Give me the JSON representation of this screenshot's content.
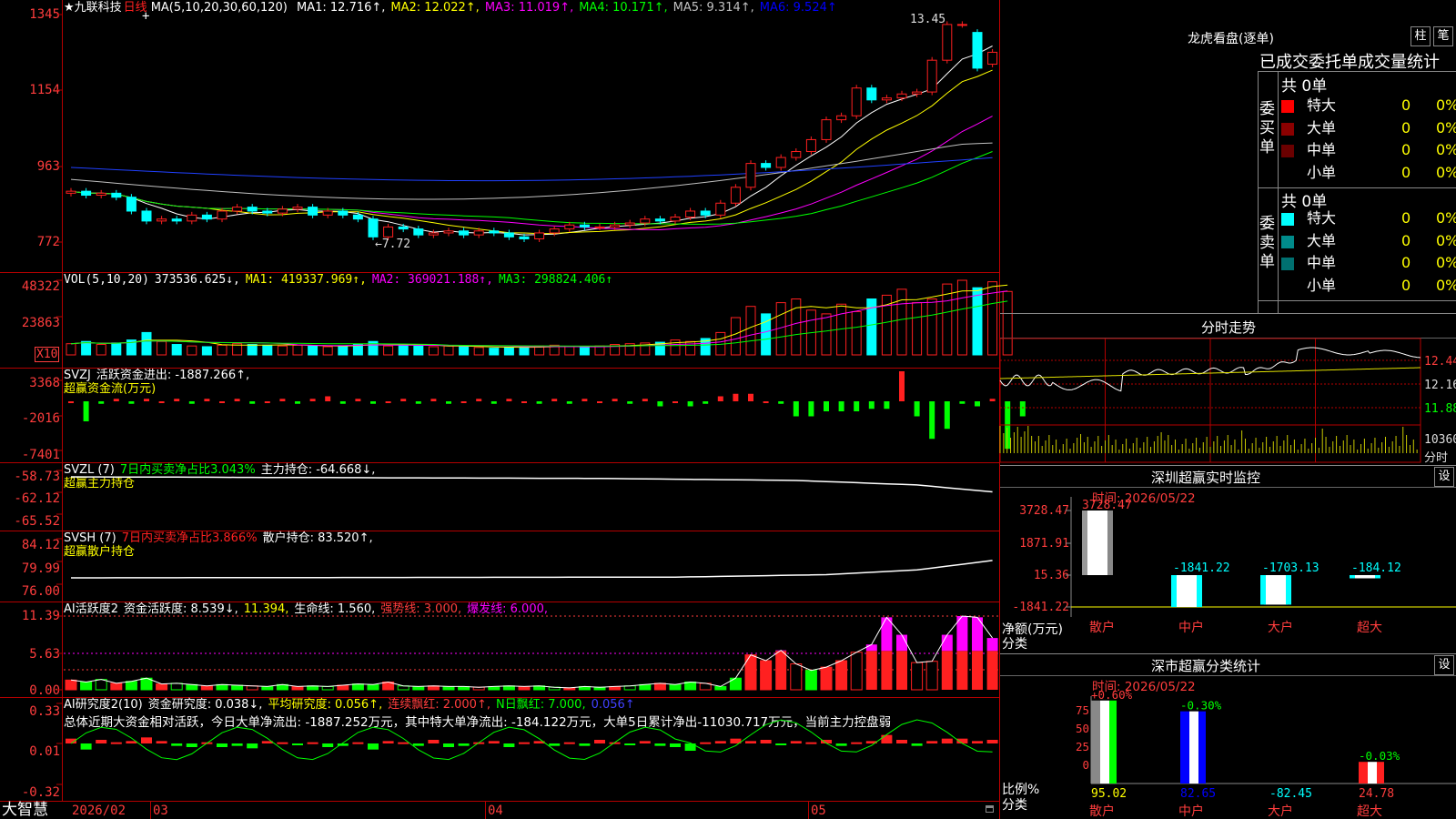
{
  "title": {
    "star": "★",
    "stock_name": "九联科技",
    "period": "日线",
    "plus": "+",
    "ma_label": "MA(5,10,20,30,60,120)",
    "ma_values": [
      {
        "text": "MA1: 12.716↑,",
        "color": "#ffffff"
      },
      {
        "text": "MA2: 12.022↑,",
        "color": "#ffff00"
      },
      {
        "text": "MA3: 11.019↑,",
        "color": "#ff00ff"
      },
      {
        "text": "MA4: 10.171↑,",
        "color": "#00ff00"
      },
      {
        "text": "MA5: 9.314↑,",
        "color": "#c0c0c0"
      },
      {
        "text": "MA6: 9.524↑",
        "color": "#0000ff"
      }
    ]
  },
  "main_chart": {
    "y_labels": [
      "1345",
      "1154",
      "963",
      "772"
    ],
    "high_mark": "13.45",
    "low_mark": "←7.72",
    "candles": [
      {
        "o": 8.95,
        "c": 9.0
      },
      {
        "o": 9.0,
        "c": 8.9
      },
      {
        "o": 8.9,
        "c": 8.95
      },
      {
        "o": 8.95,
        "c": 8.85
      },
      {
        "o": 8.85,
        "c": 8.5
      },
      {
        "o": 8.5,
        "c": 8.25
      },
      {
        "o": 8.25,
        "c": 8.3
      },
      {
        "o": 8.3,
        "c": 8.25
      },
      {
        "o": 8.25,
        "c": 8.4
      },
      {
        "o": 8.4,
        "c": 8.3
      },
      {
        "o": 8.3,
        "c": 8.5
      },
      {
        "o": 8.5,
        "c": 8.6
      },
      {
        "o": 8.6,
        "c": 8.5
      },
      {
        "o": 8.5,
        "c": 8.45
      },
      {
        "o": 8.45,
        "c": 8.55
      },
      {
        "o": 8.55,
        "c": 8.6
      },
      {
        "o": 8.6,
        "c": 8.4
      },
      {
        "o": 8.4,
        "c": 8.5
      },
      {
        "o": 8.5,
        "c": 8.4
      },
      {
        "o": 8.4,
        "c": 8.3
      },
      {
        "o": 8.3,
        "c": 7.85
      },
      {
        "o": 7.85,
        "c": 8.1
      },
      {
        "o": 8.1,
        "c": 8.05
      },
      {
        "o": 8.05,
        "c": 7.9
      },
      {
        "o": 7.9,
        "c": 7.95
      },
      {
        "o": 7.95,
        "c": 8.0
      },
      {
        "o": 8.0,
        "c": 7.9
      },
      {
        "o": 7.9,
        "c": 8.0
      },
      {
        "o": 8.0,
        "c": 7.95
      },
      {
        "o": 7.95,
        "c": 7.85
      },
      {
        "o": 7.85,
        "c": 7.8
      },
      {
        "o": 7.8,
        "c": 7.95
      },
      {
        "o": 7.95,
        "c": 8.05
      },
      {
        "o": 8.05,
        "c": 8.15
      },
      {
        "o": 8.15,
        "c": 8.1
      },
      {
        "o": 8.1,
        "c": 8.1
      },
      {
        "o": 8.1,
        "c": 8.15
      },
      {
        "o": 8.15,
        "c": 8.2
      },
      {
        "o": 8.2,
        "c": 8.3
      },
      {
        "o": 8.3,
        "c": 8.25
      },
      {
        "o": 8.25,
        "c": 8.35
      },
      {
        "o": 8.35,
        "c": 8.5
      },
      {
        "o": 8.5,
        "c": 8.4
      },
      {
        "o": 8.4,
        "c": 8.7
      },
      {
        "o": 8.7,
        "c": 9.1
      },
      {
        "o": 9.1,
        "c": 9.7
      },
      {
        "o": 9.7,
        "c": 9.6
      },
      {
        "o": 9.6,
        "c": 9.85
      },
      {
        "o": 9.85,
        "c": 10.0
      },
      {
        "o": 10.0,
        "c": 10.3
      },
      {
        "o": 10.3,
        "c": 10.8
      },
      {
        "o": 10.8,
        "c": 10.9
      },
      {
        "o": 10.9,
        "c": 11.6
      },
      {
        "o": 11.6,
        "c": 11.3
      },
      {
        "o": 11.3,
        "c": 11.35
      },
      {
        "o": 11.35,
        "c": 11.45
      },
      {
        "o": 11.45,
        "c": 11.5
      },
      {
        "o": 11.5,
        "c": 12.3
      },
      {
        "o": 12.3,
        "c": 13.2
      },
      {
        "o": 13.2,
        "c": 13.2
      },
      {
        "o": 13.0,
        "c": 12.1
      },
      {
        "o": 12.2,
        "c": 12.5
      }
    ]
  },
  "vol": {
    "title": "VOL(5,10,20)",
    "value": "373536.625↓,",
    "ma1": "MA1: 419337.969↑,",
    "ma2": "MA2: 369021.188↑,",
    "ma3": "MA3: 298824.406↑",
    "y_labels": [
      "48322",
      "23863"
    ],
    "unit": "X10",
    "bars": [
      0.15,
      0.18,
      0.14,
      0.16,
      0.2,
      0.3,
      0.18,
      0.14,
      0.12,
      0.11,
      0.13,
      0.15,
      0.14,
      0.13,
      0.12,
      0.13,
      0.12,
      0.11,
      0.12,
      0.14,
      0.18,
      0.12,
      0.13,
      0.12,
      0.11,
      0.12,
      0.11,
      0.1,
      0.09,
      0.1,
      0.11,
      0.12,
      0.13,
      0.11,
      0.1,
      0.12,
      0.14,
      0.15,
      0.16,
      0.17,
      0.2,
      0.18,
      0.22,
      0.3,
      0.5,
      0.65,
      0.55,
      0.7,
      0.75,
      0.6,
      0.55,
      0.68,
      0.58,
      0.75,
      0.8,
      0.88,
      0.7,
      0.75,
      0.95,
      1.0,
      0.9,
      0.98,
      0.85
    ]
  },
  "svzj": {
    "title": "SVZJ",
    "label1": "活跃资金进出: -1887.266↑,",
    "label2": "超赢资金流(万元)",
    "y_labels": [
      "3368",
      "-2016",
      "-7401"
    ],
    "bars": [
      0,
      -0.4,
      -0.05,
      0.05,
      -0.05,
      0.05,
      0,
      0.05,
      -0.05,
      0.05,
      0,
      0.05,
      -0.05,
      0,
      0.05,
      -0.05,
      0.05,
      0.1,
      -0.05,
      0.05,
      -0.05,
      0,
      0.05,
      -0.05,
      0.05,
      -0.05,
      0,
      0.05,
      -0.05,
      0.05,
      0,
      -0.05,
      0.05,
      -0.05,
      0.05,
      0,
      0.05,
      -0.05,
      0.05,
      -0.1,
      0,
      -0.1,
      -0.05,
      0.1,
      0.15,
      0.15,
      0,
      -0.05,
      -0.3,
      -0.3,
      -0.2,
      -0.2,
      -0.2,
      -0.15,
      -0.15,
      0.6,
      -0.3,
      -0.75,
      -0.55,
      -0.05,
      -0.1,
      0.05,
      -0.95,
      -0.3
    ]
  },
  "svzl": {
    "title": "SVZL (7)",
    "label1": "7日内买卖净占比3.043%",
    "label2": "主力持仓: -64.668↓,",
    "label3": "超赢主力持仓",
    "y_labels": [
      "-58.73",
      "-62.12",
      "-65.52"
    ]
  },
  "svsh": {
    "title": "SVSH (7)",
    "label1": "7日内买卖净占比3.866%",
    "label2": "散户持仓: 83.520↑,",
    "label3": "超赢散户持仓",
    "y_labels": [
      "84.12",
      "79.99",
      "76.00"
    ]
  },
  "ai_active": {
    "title": "AI活跃度2",
    "label1": "资金活跃度: 8.539↓,",
    "label2": "11.394,",
    "label3": "生命线: 1.560,",
    "label4": "强势线: 3.000,",
    "label5": "爆发线: 6.000,",
    "y_labels": [
      "11.39",
      "5.63",
      "0.00"
    ]
  },
  "ai_research": {
    "title": "AI研究度2(10)",
    "label1": "资金研究度: 0.038↓,",
    "label2": "平均研究度: 0.056↑,",
    "label3": "连续飘红: 2.000↑,",
    "label4": "N日飘红: 7.000,",
    "label5": "0.056↑",
    "summary": "总体近期大资金相对活跃，今日大单净流出: -1887.252万元，其中特大单净流出: -184.122万元，大单5日累计净出-11030.717万元，当前主力控盘弱",
    "y_labels": [
      "0.33",
      "0.01",
      "-0.32"
    ]
  },
  "bottom_bar": {
    "brand": "大智慧",
    "dates": [
      "2026/02",
      "03",
      "04",
      "05"
    ]
  },
  "right": {
    "lhb": {
      "title": "龙虎看盘(逐单)",
      "btn_bar": "柱",
      "btn_stroke": "笔",
      "tabs_text": "已成交委托单成交量统计",
      "buy_side": "委买单",
      "sell_side": "委卖单",
      "buy_total": "共 0单",
      "sell_total": "共 0单",
      "buy_rows": [
        {
          "name": "特大",
          "count": "0",
          "pct": "0%",
          "color": "#ff0000"
        },
        {
          "name": "大单",
          "count": "0",
          "pct": "0%",
          "color": "#8b0000"
        },
        {
          "name": "中单",
          "count": "0",
          "pct": "0%",
          "color": "#6b0000"
        },
        {
          "name": "小单",
          "count": "0",
          "pct": "0%",
          "color": ""
        }
      ],
      "sell_rows": [
        {
          "name": "特大",
          "count": "0",
          "pct": "0%",
          "color": "#00ffff"
        },
        {
          "name": "大单",
          "count": "0",
          "pct": "0%",
          "color": "#008b8b"
        },
        {
          "name": "中单",
          "count": "0",
          "pct": "0%",
          "color": "#007070"
        },
        {
          "name": "小单",
          "count": "0",
          "pct": "0%",
          "color": ""
        }
      ]
    },
    "intraday": {
      "title": "分时走势",
      "y_labels": [
        "12.44",
        "12.16",
        "11.88"
      ],
      "vol_label": "10360",
      "unit": "分时"
    },
    "monitor": {
      "title": "深圳超赢实时监控",
      "settings": "设",
      "time": "时间: 2026/05/22",
      "y_labels": [
        "3728.47",
        "1871.91",
        "15.36",
        "-1841.22"
      ],
      "value_labels": [
        "3728.47",
        "-1841.22",
        "-1703.13",
        "-184.12"
      ],
      "axis_title": "净额(万元)",
      "axis_sub": "分类",
      "categories": [
        "散户",
        "中户",
        "大户",
        "超大"
      ],
      "values": [
        3728.47,
        -1841.22,
        -1703.13,
        -184.12
      ]
    },
    "classify": {
      "title": "深市超赢分类统计",
      "settings": "设",
      "time": "时间: 2026/05/22",
      "y_labels": [
        "75",
        "50",
        "25",
        "0"
      ],
      "axis_title": "比例%",
      "axis_sub": "分类",
      "changes": [
        "+0.60%",
        "-0.30%",
        "",
        "-0.03%"
      ],
      "values_text": [
        "95.02",
        "82.65",
        "-82.45",
        "24.78"
      ],
      "values": [
        95.02,
        82.65,
        -82.45,
        24.78
      ],
      "categories": [
        "散户",
        "中户",
        "大户",
        "超大"
      ]
    }
  }
}
